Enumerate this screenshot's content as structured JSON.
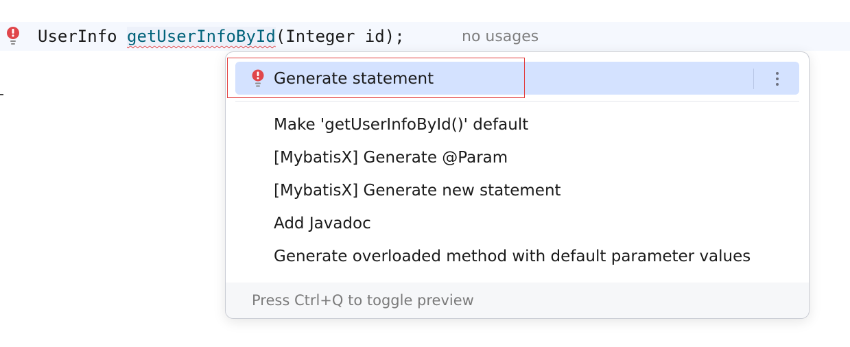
{
  "editor": {
    "code": {
      "return_type": "UserInfo ",
      "method_name": "getUserInfoById",
      "params": "(Integer id);",
      "usages_hint": "no usages"
    }
  },
  "popup": {
    "selected_item": {
      "label": "Generate statement",
      "icon": "lightbulb-error-icon"
    },
    "items": [
      {
        "label": "Make 'getUserInfoById()' default"
      },
      {
        "label": "[MybatisX] Generate @Param"
      },
      {
        "label": "[MybatisX] Generate new statement"
      },
      {
        "label": "Add Javadoc"
      },
      {
        "label": "Generate overloaded method with default parameter values"
      }
    ],
    "footer": "Press Ctrl+Q to toggle preview"
  },
  "colors": {
    "accent_error": "#e0464b",
    "selected_bg": "#d4e2ff",
    "method_name": "#00627a",
    "highlight_frame": "#e23b3b"
  }
}
